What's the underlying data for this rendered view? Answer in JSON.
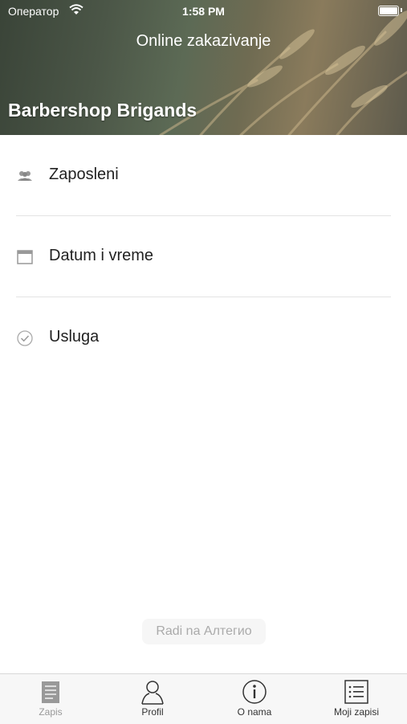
{
  "status": {
    "carrier": "Оператор",
    "time": "1:58 PM"
  },
  "header": {
    "title": "Online zakazivanje",
    "shop_name": "Barbershop Brigands"
  },
  "menu": [
    {
      "label": "Zaposleni",
      "icon": "people-icon"
    },
    {
      "label": "Datum i vreme",
      "icon": "calendar-icon"
    },
    {
      "label": "Usluga",
      "icon": "checkmark-circle-icon"
    }
  ],
  "footer": {
    "powered_by": "Radi na Алтегио"
  },
  "tabs": [
    {
      "label": "Zapis",
      "icon": "document-icon",
      "active": true
    },
    {
      "label": "Profil",
      "icon": "person-icon",
      "active": false
    },
    {
      "label": "O nama",
      "icon": "info-icon",
      "active": false
    },
    {
      "label": "Moji zapisi",
      "icon": "list-icon",
      "active": false
    }
  ]
}
